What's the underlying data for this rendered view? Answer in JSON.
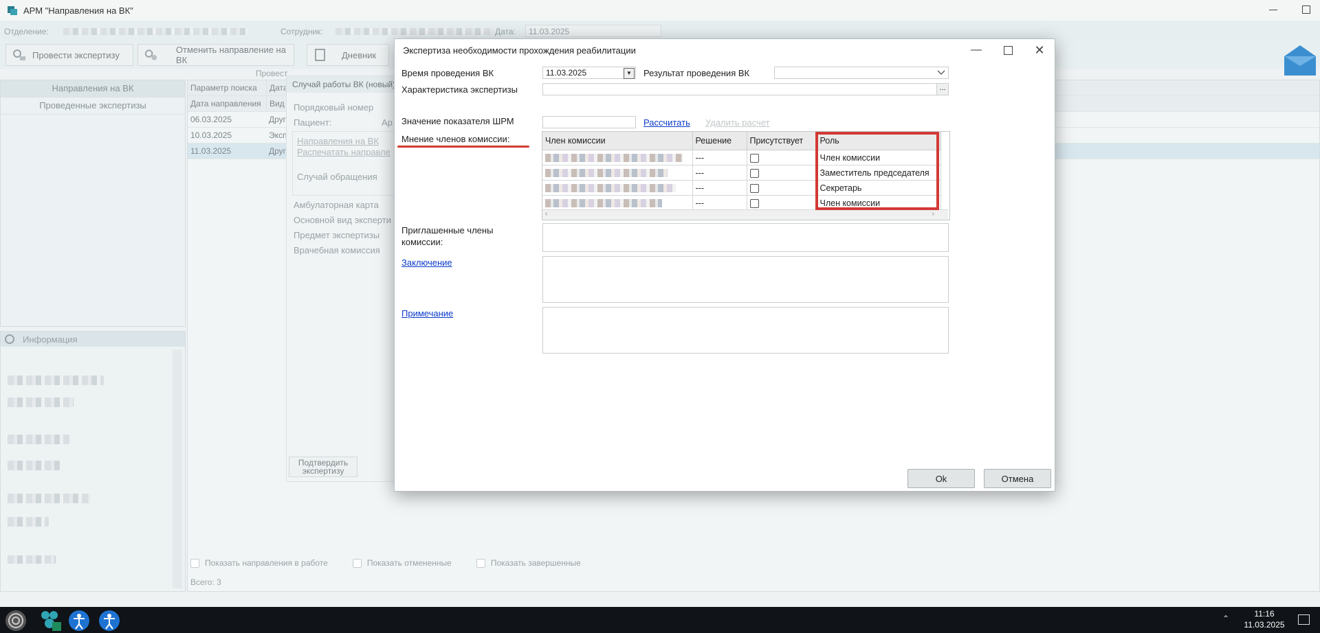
{
  "app": {
    "title": "АРМ \"Направления на ВК\"",
    "filters": {
      "department_label": "Отделение:",
      "employee_label": "Сотрудник:",
      "date_label": "Дата:",
      "date_value": "11.03.2025"
    },
    "toolbar": {
      "conduct": "Провести экспертизу",
      "cancel_referral": "Отменить направление на ВК",
      "diary": "Дневник",
      "section": "Провест"
    },
    "nav": {
      "items": [
        "Направления на ВК",
        "Проведенные экспертизы"
      ]
    },
    "info": {
      "label": "Информация"
    },
    "grid": {
      "search_headers": [
        "Параметр поиска",
        "Дата"
      ],
      "headers": [
        "Дата направления",
        "Вид э"
      ],
      "rows": [
        {
          "date": "06.03.2025",
          "type": "Друг"
        },
        {
          "date": "10.03.2025",
          "type": "Эксп"
        },
        {
          "date": "11.03.2025",
          "type": "Друг"
        }
      ],
      "checkboxes": [
        "Показать направления в работе",
        "Показать отмененные",
        "Показать завершенные"
      ],
      "total": "Всего:  3"
    },
    "case": {
      "title": "Случай работы ВК (новый)",
      "order_label": "Порядковый номер",
      "patient_label": "Пациент:",
      "patient_btn": "Ар",
      "links": [
        "Направления на ВК",
        "Распечатать направле"
      ],
      "appeal": "Случай обращения",
      "fields": [
        "Амбулаторная карта",
        "Основной вид эксперти",
        "Предмет экспертизы",
        "Врачебная комиссия"
      ],
      "confirm_btn": "Подтвердить экспертизу"
    }
  },
  "dialog": {
    "title": "Экспертиза необходимости прохождения реабилитации",
    "vk_time_label": "Время проведения ВК",
    "vk_time_value": "11.03.2025",
    "vk_result_label": "Результат проведения ВК",
    "characteristic_label": "Характеристика экспертизы",
    "ellipsis": "...",
    "shrm_label": "Значение показателя ШРМ",
    "calc_link": "Рассчитать",
    "delete_calc_link": "Удалить расчет",
    "opinion_label": "Мнение членов комиссии:",
    "table": {
      "headers": [
        "Член комиссии",
        "Решение",
        "Присутствует",
        "Роль"
      ],
      "rows": [
        {
          "decision": "---",
          "role": "Член комиссии"
        },
        {
          "decision": "---",
          "role": "Заместитель председателя"
        },
        {
          "decision": "---",
          "role": "Секретарь"
        },
        {
          "decision": "---",
          "role": "Член комиссии"
        }
      ]
    },
    "invited_label": "Приглашенные члены комиссии:",
    "conclusion_link": "Заключение",
    "note_link": "Примечание",
    "ok": "Ok",
    "cancel": "Отмена"
  },
  "taskbar": {
    "time": "11:16",
    "date": "11.03.2025"
  },
  "colors": {
    "accent_red": "#d23a35",
    "link": "#0a39c9"
  }
}
